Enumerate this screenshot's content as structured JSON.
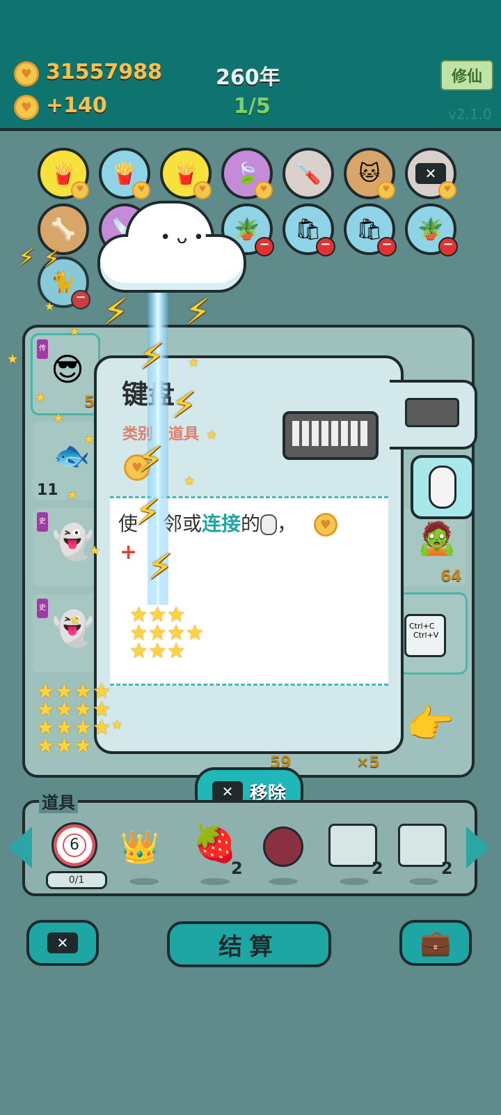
{
  "header": {
    "coins": "31557988",
    "income": "+140",
    "year": "260年",
    "progress": "1/5",
    "xiuxian_label": "修仙",
    "version": "v2.1.0"
  },
  "board": {
    "row1": [
      "fries",
      "fries",
      "fries",
      "leaf",
      "screwdriver",
      "cat-pair",
      "remove-tag"
    ],
    "row2": [
      "dog-bowl",
      "saw",
      "potted-flower",
      "trash-bag",
      "trash-bag",
      "potted-flower"
    ],
    "cells": {
      "fish_count": "11",
      "face_count": "5",
      "green_face_count": "64",
      "bottom_num": "59",
      "multiplier": "×5",
      "ctrl_c": "Ctrl+C",
      "ctrl_v": "Ctrl+V"
    }
  },
  "card": {
    "title": "键盘",
    "category": "类别：道具",
    "desc_prefix": "使",
    "desc_mid": "邻或",
    "desc_highlight": "连接",
    "desc_suffix": "的",
    "desc_comma": "，",
    "plus": "+"
  },
  "remove": {
    "label": "移除"
  },
  "tools": {
    "label": "道具",
    "target_number": "6",
    "target_progress": "0/1",
    "strawberry_count": "2",
    "slot1_count": "2",
    "slot2_count": "2"
  },
  "bottom": {
    "settle_label": "结算"
  },
  "colors": {
    "primary": "#0f7470",
    "accent": "#1fb7b8",
    "gold": "#f5c04f"
  }
}
